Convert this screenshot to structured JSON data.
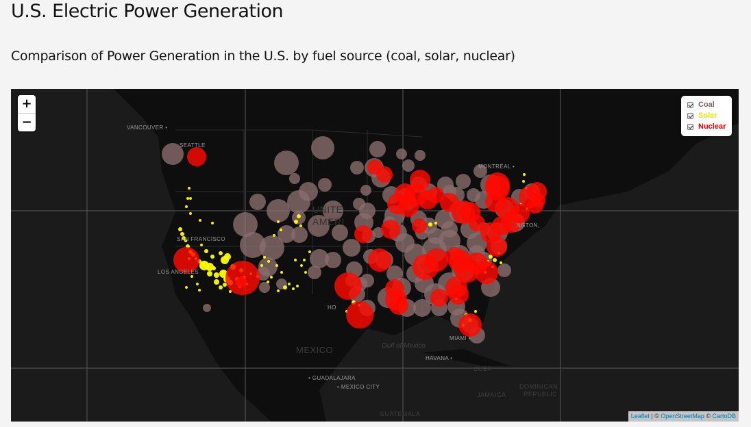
{
  "title": "U.S. Electric Power Generation",
  "subtitle": "Comparison of Power Generation in the U.S. by fuel source (coal, solar, nuclear)",
  "zoom": {
    "in_label": "+",
    "out_label": "−"
  },
  "layers": [
    {
      "label": "Coal",
      "color": "#7a6060",
      "checked": true
    },
    {
      "label": "Solar",
      "color": "#e6e600",
      "checked": true
    },
    {
      "label": "Nuclear",
      "color": "#e60000",
      "checked": true
    }
  ],
  "attribution": {
    "leaflet": "Leaflet",
    "sep1": " | © ",
    "osm": "OpenStreetMap",
    "sep2": " © ",
    "carto": "CartoDB"
  },
  "map_labels": {
    "vancouver": "VANCOUVER •",
    "seattle": "SEATTLE",
    "san_francisco": "SAN FRANCISCO",
    "los_angeles": "LOS ANGELES",
    "montreal": "MONTRÉAL •",
    "washington": "NGTON,",
    "miami": "MIAMI •",
    "havana": "HAVANA •",
    "guadalajara": "• GUADALAJARA",
    "mexico_city": "• MEXICO CITY",
    "mexico": "MEXICO",
    "gulf": "Gulf of Mexico",
    "cuba": "CUBA",
    "jamaica": "JAMAICA",
    "dominican1": "DOMINICAN",
    "dominican2": "REPUBLIC",
    "guatemala": "GUATEMALA",
    "houston": "HO",
    "united_states1": "UNITE",
    "united_states2": "AMERI"
  },
  "colors": {
    "coal": "#8a6e6e",
    "solar": "#ffff00",
    "nuclear": "#ff0a00",
    "map_bg": "#1b1b1b",
    "land": "#0e0e0e"
  }
}
